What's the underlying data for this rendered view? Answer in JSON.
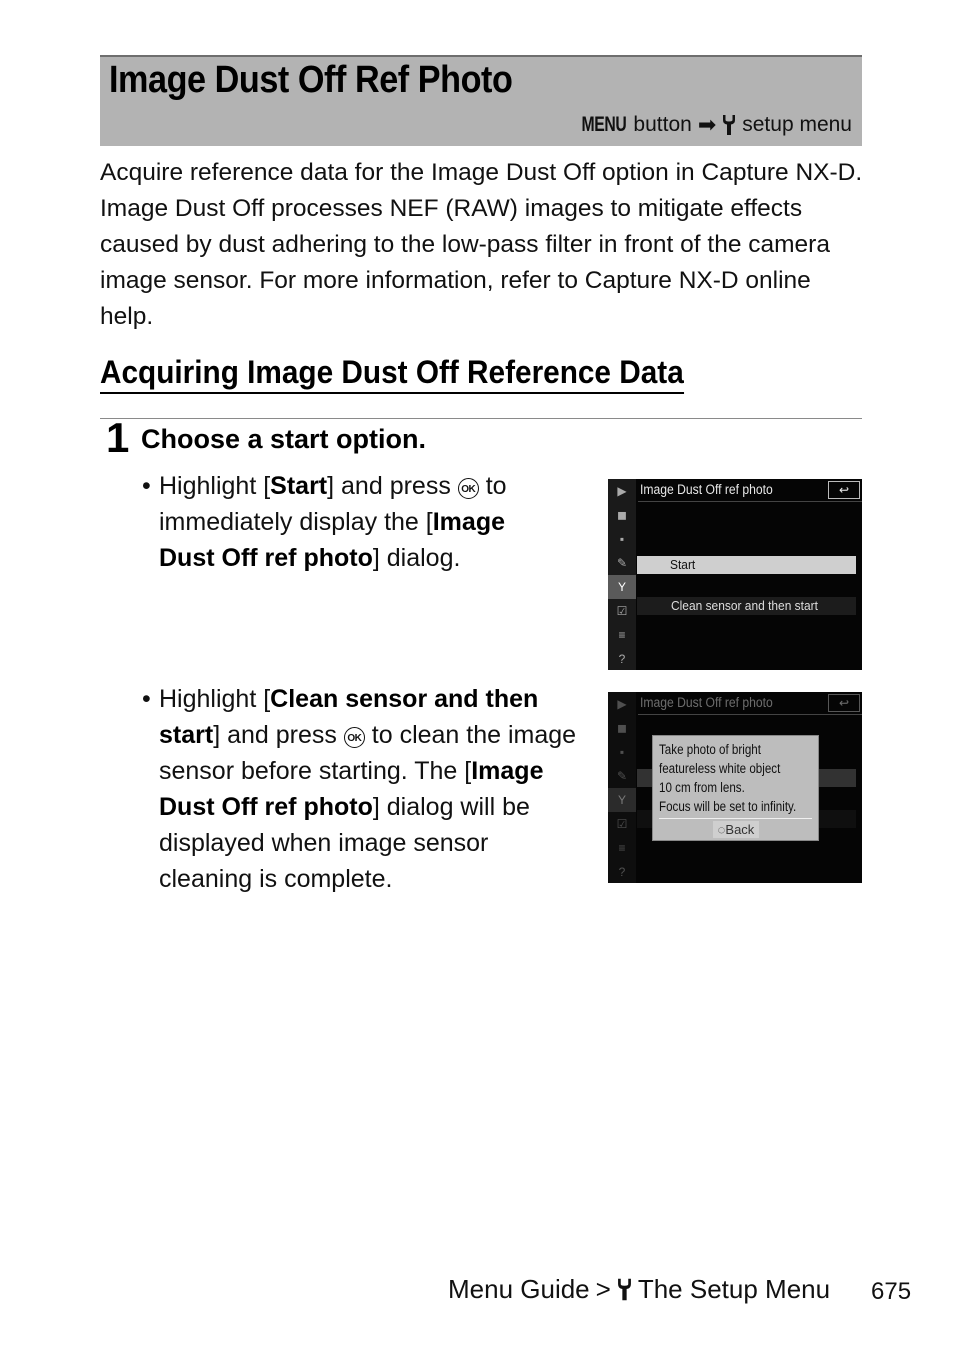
{
  "header": {
    "title": "Image Dust Off Ref Photo",
    "nav": {
      "menu_button": "MENU",
      "button_label": "button",
      "arrow": "➡",
      "menu_icon": "wrench-icon",
      "destination": "setup menu"
    }
  },
  "intro": "Acquire reference data for the Image Dust Off option in Capture NX-D. Image Dust Off processes NEF (RAW) images to mitigate effects caused by dust adhering to the low-pass filter in front of the camera image sensor. For more information, refer to Capture NX-D online help.",
  "section": {
    "heading": "Acquiring Image Dust Off Reference Data"
  },
  "step": {
    "number": "1",
    "title": "Choose a start option.",
    "bullets": [
      {
        "parts": {
          "a": "Highlight [",
          "b": "Start",
          "c": "] and press ",
          "ok": "OK",
          "d": " to immediately display the [",
          "e": "Image Dust Off ref photo",
          "f": "] dialog."
        }
      },
      {
        "parts": {
          "a": "Highlight [",
          "b": "Clean sensor and then start",
          "c": "] and press ",
          "ok": "OK",
          "d": " to clean the image sensor before starting. The [",
          "e": "Image Dust Off ref photo",
          "f": "] dialog will be displayed when image sensor cleaning is complete."
        }
      }
    ]
  },
  "screens": [
    {
      "title": "Image Dust Off ref photo",
      "back": "↩",
      "options": [
        "Start",
        "Clean sensor and then start"
      ],
      "selected": 0
    },
    {
      "title": "Image Dust Off ref photo",
      "back": "↩",
      "options": [
        "",
        "Clean sensor and then start"
      ],
      "dialog": {
        "lines": [
          "Take photo of bright",
          "featureless white object",
          "10 cm from lens.",
          "Focus will be set to infinity."
        ],
        "back_label": "Back"
      }
    }
  ],
  "sidebar_icons": [
    "playback-icon",
    "camera-icon",
    "movie-icon",
    "pencil-icon",
    "wrench-icon",
    "retouch-icon",
    "my-menu-icon",
    "help-icon"
  ],
  "footer": {
    "breadcrumb_parent": "Menu Guide",
    "separator": ">",
    "breadcrumb_current": "The Setup Menu",
    "page_number": "675"
  }
}
